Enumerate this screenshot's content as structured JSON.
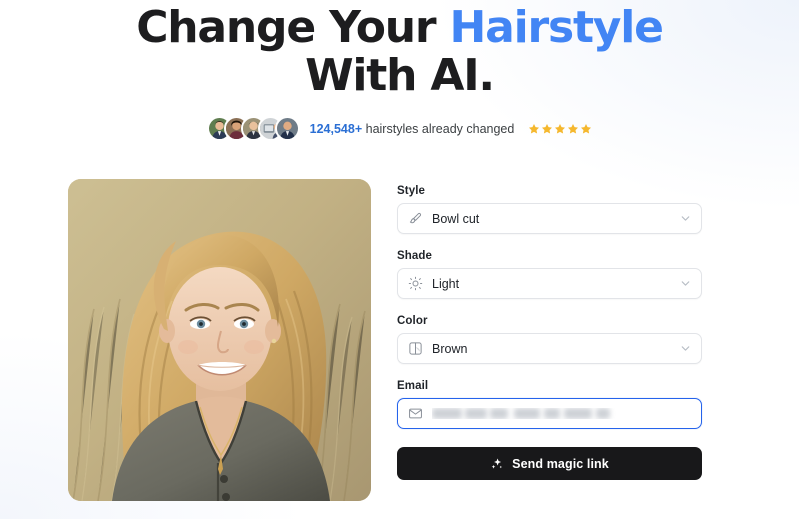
{
  "hero": {
    "line1_part1": "Change Your ",
    "line1_accent": "Hairstyle",
    "line2": "With AI.",
    "accent_color": "#4285f4"
  },
  "social_proof": {
    "count": "124,548+",
    "count_color": "#2b6fd4",
    "text": "hairstyles already changed",
    "rating": 5,
    "star_color": "#f5b82e",
    "avatars": [
      {
        "name": "avatar-person-1"
      },
      {
        "name": "avatar-person-2"
      },
      {
        "name": "avatar-person-3"
      },
      {
        "name": "avatar-person-4"
      },
      {
        "name": "avatar-person-5"
      }
    ]
  },
  "photo": {
    "alt": "Portrait of smiling blonde woman in gray top outdoors",
    "icon": "portrait-photo"
  },
  "form": {
    "style": {
      "label": "Style",
      "value": "Bowl cut",
      "icon": "paintbrush-icon",
      "chevron": "chevron-down-icon"
    },
    "shade": {
      "label": "Shade",
      "value": "Light",
      "icon": "sun-icon",
      "chevron": "chevron-down-icon"
    },
    "color": {
      "label": "Color",
      "value": "Brown",
      "icon": "color-swatch-icon",
      "chevron": "chevron-down-icon"
    },
    "email": {
      "label": "Email",
      "value": "",
      "placeholder": "",
      "icon": "envelope-icon",
      "focused": true,
      "focus_color": "#2563eb"
    },
    "submit": {
      "label": "Send magic link",
      "icon": "sparkles-icon",
      "background": "#18181a"
    }
  }
}
